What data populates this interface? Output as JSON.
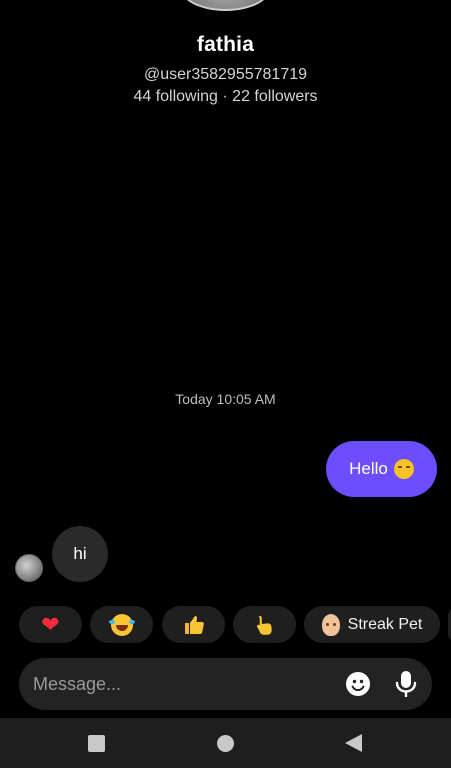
{
  "profile": {
    "name": "fathia",
    "handle": "@user3582955781719",
    "stats": "44 following · 22 followers"
  },
  "chat": {
    "timestamp": "Today 10:05 AM",
    "messages": [
      {
        "direction": "sent",
        "text": "Hello",
        "emoji": "hugging-face-emoji"
      },
      {
        "direction": "received",
        "text": "hi"
      }
    ]
  },
  "quick_reactions": [
    {
      "icon": "heart-emoji"
    },
    {
      "icon": "laughing-tears-emoji"
    },
    {
      "icon": "thumbs-up-emoji"
    },
    {
      "icon": "pointing-hand-emoji"
    },
    {
      "icon": "egg-emoji",
      "label": "Streak Pet"
    }
  ],
  "composer": {
    "placeholder": "Message...",
    "value": ""
  },
  "colors": {
    "background": "#000000",
    "sent_bubble": "#6c4dff",
    "received_bubble": "#2a2a2a",
    "chip": "#1f1f1f",
    "composer": "#232323"
  }
}
